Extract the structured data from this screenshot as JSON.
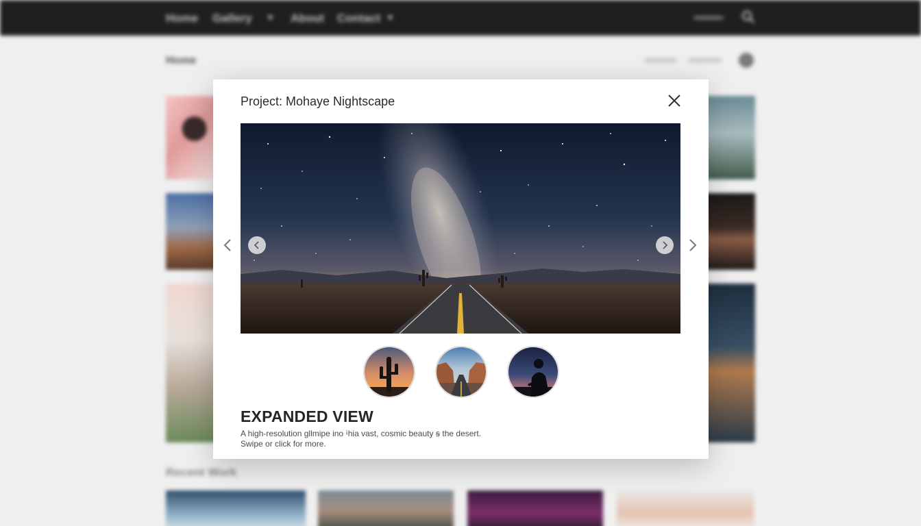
{
  "background_page": {
    "nav": {
      "items": [
        "Home",
        "Gallery",
        "About",
        "Contact"
      ]
    },
    "breadcrumb": "Home",
    "section_heading": "Recent Work"
  },
  "modal": {
    "title": "Project: Mohaye Nightscape",
    "heading": "EXPANDED VIEW",
    "description_line1": "A high-resolution gllmipe ino ꜟhia vast, cosmic beauty ꞩ the desert.",
    "description_line2": "Swipe or click for more.",
    "thumbnails": [
      {
        "name": "saguaro-sunset"
      },
      {
        "name": "desert-canyon-road"
      },
      {
        "name": "silhouette-night"
      }
    ],
    "selected_thumbnail": 1
  },
  "icons": {
    "close": "close-icon",
    "prev": "chevron-left-icon",
    "next": "chevron-right-icon",
    "search": "search-icon"
  },
  "colors": {
    "nav_bg": "#1f1f1f",
    "page_bg": "#efefef",
    "modal_bg": "#ffffff"
  }
}
